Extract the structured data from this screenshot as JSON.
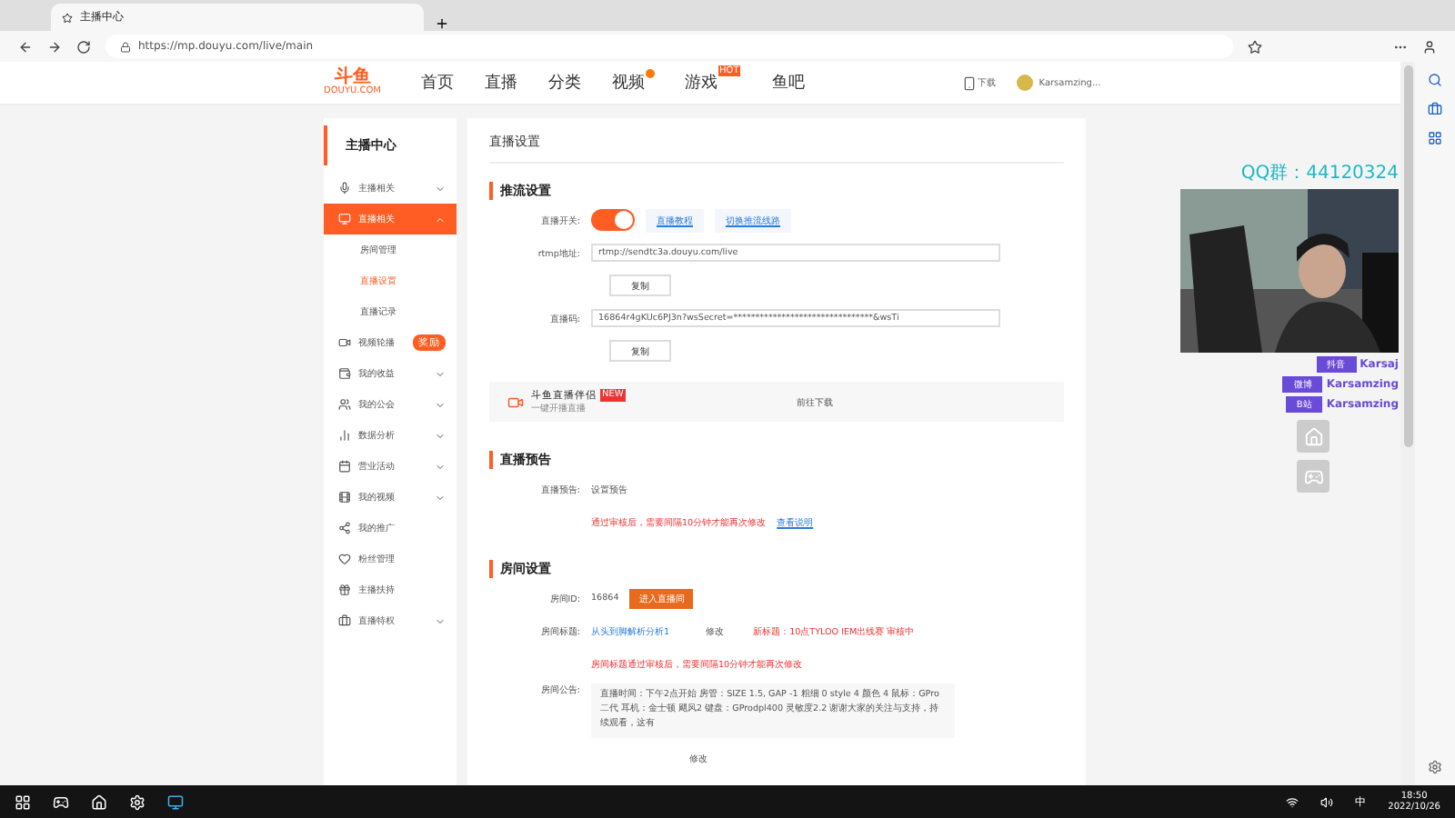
{
  "browser": {
    "tab_title": "主播中心",
    "url": "https://mp.douyu.com/live/main"
  },
  "site_header": {
    "logo": "斗鱼",
    "logo_sub": "DOUYU.COM",
    "nav": [
      {
        "label": "首页"
      },
      {
        "label": "直播"
      },
      {
        "label": "分类"
      },
      {
        "label": "视频",
        "dot": true
      },
      {
        "label": "游戏",
        "badge": "HOT"
      },
      {
        "label": "鱼吧"
      }
    ],
    "download": "下载",
    "user": "Karsamzing..."
  },
  "sidebar": {
    "title": "主播中心",
    "items": [
      {
        "label": "主播相关",
        "selected": false,
        "expanded": false
      },
      {
        "label": "直播相关",
        "selected": true,
        "expanded": true,
        "children": [
          {
            "label": "房间管理",
            "selected": false
          },
          {
            "label": "直播设置",
            "selected": true
          },
          {
            "label": "直播记录",
            "selected": false
          }
        ]
      },
      {
        "label": "视频轮播",
        "selected": false,
        "badge": "奖励"
      },
      {
        "label": "我的收益",
        "selected": false,
        "expanded": false
      },
      {
        "label": "我的公会",
        "selected": false,
        "expanded": false
      },
      {
        "label": "数据分析",
        "selected": false,
        "expanded": false
      },
      {
        "label": "营业活动",
        "selected": false,
        "expanded": false
      },
      {
        "label": "我的视频",
        "selected": false,
        "expanded": false
      },
      {
        "label": "我的推广",
        "selected": false
      },
      {
        "label": "粉丝管理",
        "selected": false
      },
      {
        "label": "主播扶持",
        "selected": false
      },
      {
        "label": "直播特权",
        "selected": false,
        "expanded": false
      }
    ]
  },
  "page_title": "直播设置",
  "stream": {
    "heading": "推流设置",
    "switch_label": "直播开关:",
    "switch_on": true,
    "links": [
      "直播教程",
      "切换推流线路"
    ],
    "fields": [
      {
        "label": "rtmp地址:",
        "value": "rtmp://sendtc3a.douyu.com/live",
        "button": "复制"
      },
      {
        "label": "直播码:",
        "value": "16864r4gKUc6PJ3n?wsSecret=********************************&wsTi",
        "button": "复制"
      }
    ]
  },
  "companion": {
    "title": "斗鱼直播伴侣",
    "badge": "NEW",
    "subtitle": "一键开播直播",
    "action": "前往下载"
  },
  "preview": {
    "heading": "直播预告",
    "label": "直播预告:",
    "value": "设置预告",
    "note": "通过审核后，需要间隔10分钟才能再次修改",
    "link": "查看说明"
  },
  "room": {
    "heading": "房间设置",
    "id_label": "房间ID:",
    "id": "16864",
    "enter_button": "进入直播间",
    "title_label": "房间标题:",
    "title": "从头到脚解析分析1",
    "edit": "修改",
    "new_title": "新标题：10点TYLOO IEM出线赛  审核中",
    "title_note": "房间标题通过审核后，需要间隔10分钟才能再次修改",
    "notice_label": "房间公告:",
    "notice": "直播时间：下午2点开始 房管：SIZE 1.5, GAP -1 粗细 0 style 4 颜色 4 鼠标：GPro 二代 耳机：金士顿 飓风2 键盘：GProdpl400 灵敏度2.2 谢谢大家的关注与支持，持续观看，这有",
    "notice_edit": "修改"
  },
  "overlay": {
    "qq": "QQ群：44120324",
    "socials": [
      {
        "platform": "抖音",
        "handle": "Karsaj"
      },
      {
        "platform": "微博",
        "handle": "Karsamzing"
      },
      {
        "platform": "B站",
        "handle": "Karsamzing"
      }
    ]
  },
  "taskbar": {
    "ime": "中",
    "time": "18:50",
    "date": "2022/10/26"
  }
}
